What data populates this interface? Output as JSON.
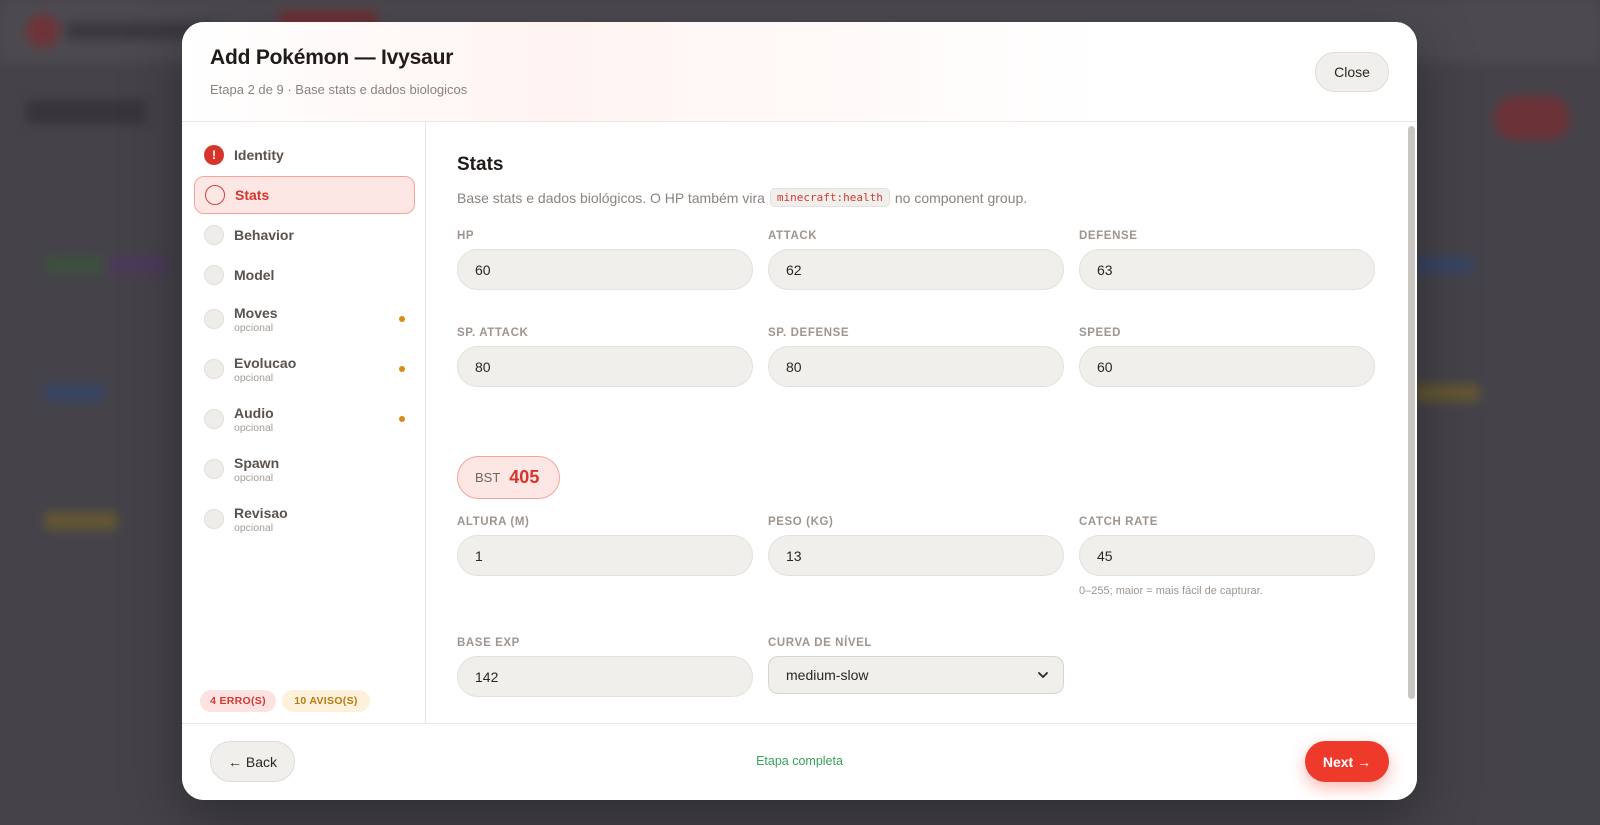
{
  "modal": {
    "title": "Add Pokémon — Ivysaur",
    "subtitle": "Etapa 2 de 9 · Base stats e dados biologicos",
    "close_label": "Close"
  },
  "sidebar": {
    "steps": [
      {
        "label": "Identity",
        "sub": "",
        "state": "error"
      },
      {
        "label": "Stats",
        "sub": "",
        "state": "active"
      },
      {
        "label": "Behavior",
        "sub": "",
        "state": "pending"
      },
      {
        "label": "Model",
        "sub": "",
        "state": "pending"
      },
      {
        "label": "Moves",
        "sub": "opcional",
        "state": "warning"
      },
      {
        "label": "Evolucao",
        "sub": "opcional",
        "state": "warning"
      },
      {
        "label": "Audio",
        "sub": "opcional",
        "state": "warning"
      },
      {
        "label": "Spawn",
        "sub": "opcional",
        "state": "pending"
      },
      {
        "label": "Revisao",
        "sub": "opcional",
        "state": "pending"
      }
    ],
    "error_icon": "!",
    "errors_badge": "4 ERRO(S)",
    "warnings_badge": "10 AVISO(S)"
  },
  "stats": {
    "title": "Stats",
    "desc_before": "Base stats e dados biológicos. O HP também vira",
    "desc_code": "minecraft:health",
    "desc_after": "no component group.",
    "hp_label": "HP",
    "hp": "60",
    "attack_label": "ATTACK",
    "attack": "62",
    "defense_label": "DEFENSE",
    "defense": "63",
    "sp_attack_label": "SP. ATTACK",
    "sp_attack": "80",
    "sp_defense_label": "SP. DEFENSE",
    "sp_defense": "80",
    "speed_label": "SPEED",
    "speed": "60",
    "bst_label": "BST",
    "bst": "405",
    "height_label": "ALTURA (M)",
    "height": "1",
    "weight_label": "PESO (KG)",
    "weight": "13",
    "catch_rate_label": "CATCH RATE",
    "catch_rate": "45",
    "catch_rate_hint": "0–255; maior = mais fácil de capturar.",
    "base_exp_label": "BASE EXP",
    "base_exp": "142",
    "growth_label": "CURVA DE NÍVEL",
    "growth": "medium-slow"
  },
  "footer": {
    "back_label": "← Back",
    "status": "Etapa completa",
    "next_label": "Next →"
  },
  "colors": {
    "accent": "#ee3a2b",
    "error": "#d7352c",
    "warning": "#d98a17",
    "success": "#3aa15a"
  }
}
